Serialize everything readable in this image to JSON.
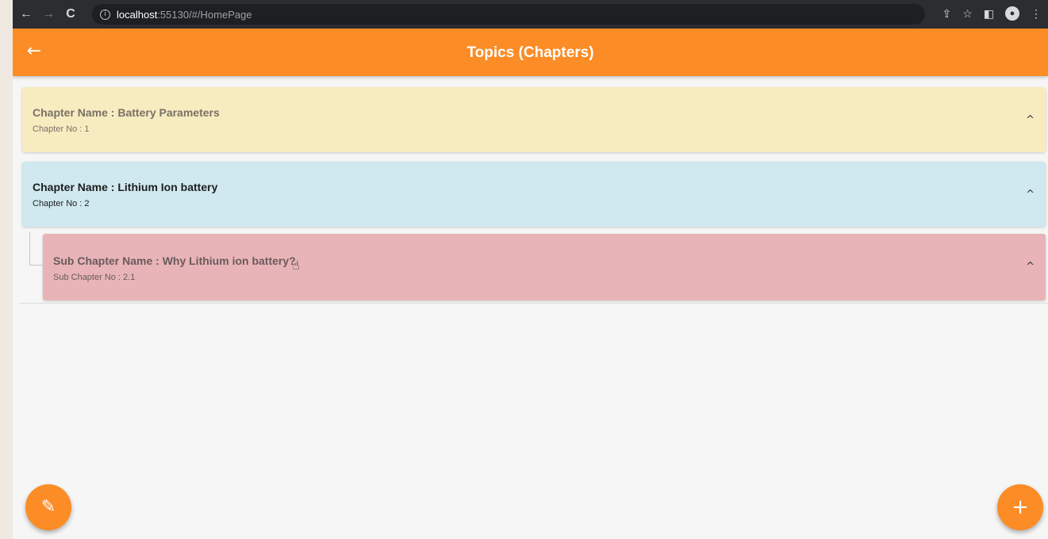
{
  "browser": {
    "back_glyph": "←",
    "forward_glyph": "→",
    "reload_glyph": "C",
    "url_host": "localhost",
    "url_rest": ":55130/#/HomePage",
    "share_glyph": "⇪",
    "star_glyph": "☆",
    "panel_glyph": "◧",
    "profile_glyph": "👤",
    "menu_glyph": "⋮"
  },
  "app_bar": {
    "title": "Topics (Chapters)",
    "back_glyph": "←",
    "color": "#fb8c26"
  },
  "chapters": [
    {
      "title": "Chapter Name : Battery Parameters",
      "subtitle": "Chapter No : 1",
      "color": "#f7ecc0",
      "chevron": "^"
    },
    {
      "title": "Chapter Name : Lithium Ion battery",
      "subtitle": "Chapter No : 2",
      "color": "#d0e8ef",
      "chevron": "^",
      "sub_chapters": [
        {
          "title": "Sub Chapter Name : Why Lithium ion battery?",
          "subtitle": "Sub Chapter No : 2.1",
          "color": "#e8b4b8",
          "chevron": "^"
        }
      ]
    }
  ],
  "fabs": {
    "edit_icon": "edit-icon",
    "edit_glyph": "✎",
    "add_icon": "add-icon",
    "add_glyph": "+"
  }
}
